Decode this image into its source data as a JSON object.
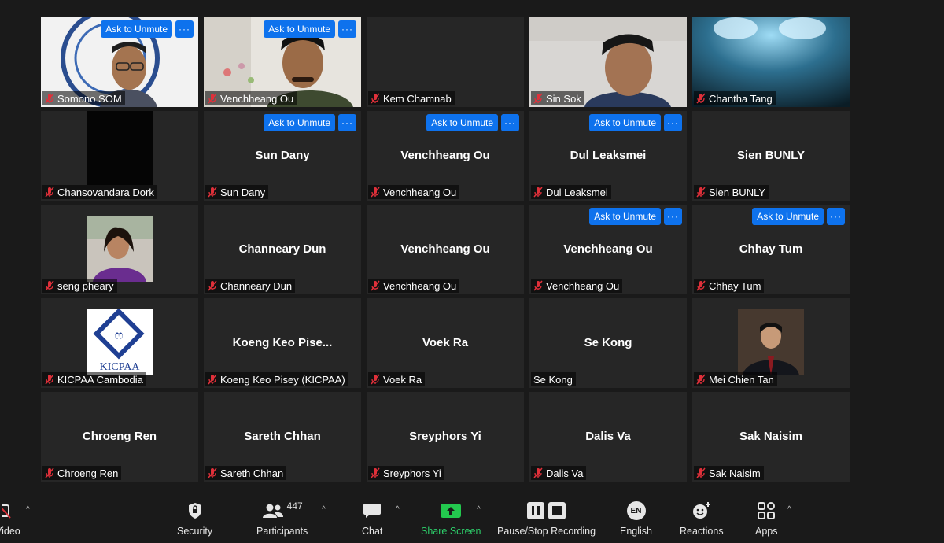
{
  "colors": {
    "accent": "#0e72ed",
    "share": "#23c84e",
    "mic_off": "#e0303a"
  },
  "unmute_label": "Ask to Unmute",
  "more_label": "···",
  "tiles": [
    {
      "name": "Somono SOM",
      "center": "",
      "video": "somono",
      "unmute": true
    },
    {
      "name": "Venchheang Ou",
      "center": "",
      "video": "venchheang",
      "unmute": true
    },
    {
      "name": "Kem Chamnab",
      "center": "",
      "video": "",
      "unmute": false
    },
    {
      "name": "Sin Sok",
      "center": "",
      "video": "sinsok",
      "unmute": false
    },
    {
      "name": "Chantha Tang",
      "center": "",
      "video": "chantha",
      "unmute": false
    },
    {
      "name": "Chansovandara Dork",
      "center": "",
      "video": "black",
      "unmute": false
    },
    {
      "name": "Sun Dany",
      "center": "Sun Dany",
      "video": "",
      "unmute": true
    },
    {
      "name": "Venchheang Ou",
      "center": "Venchheang Ou",
      "video": "",
      "unmute": true
    },
    {
      "name": "Dul Leaksmei",
      "center": "Dul Leaksmei",
      "video": "",
      "unmute": true
    },
    {
      "name": "Sien BUNLY",
      "center": "Sien BUNLY",
      "video": "",
      "unmute": false
    },
    {
      "name": "seng pheary",
      "center": "",
      "video": "photo-woman",
      "unmute": false
    },
    {
      "name": "Channeary Dun",
      "center": "Channeary Dun",
      "video": "",
      "unmute": false
    },
    {
      "name": "Venchheang Ou",
      "center": "Venchheang Ou",
      "video": "",
      "unmute": false
    },
    {
      "name": "Venchheang Ou",
      "center": "Venchheang Ou",
      "video": "",
      "unmute": true
    },
    {
      "name": "Chhay Tum",
      "center": "Chhay Tum",
      "video": "",
      "unmute": true
    },
    {
      "name": "KICPAA Cambodia",
      "center": "",
      "video": "kicpaa-logo",
      "unmute": false
    },
    {
      "name": "Koeng Keo Pisey (KICPAA)",
      "center": "Koeng  Keo  Pise...",
      "video": "",
      "unmute": false
    },
    {
      "name": "Voek Ra",
      "center": "Voek Ra",
      "video": "",
      "unmute": false
    },
    {
      "name": "Se Kong",
      "center": "Se Kong",
      "video": "",
      "unmute": false,
      "no_mic": true
    },
    {
      "name": "Mei Chien Tan",
      "center": "",
      "video": "photo-man",
      "unmute": false
    },
    {
      "name": "Chroeng Ren",
      "center": "Chroeng Ren",
      "video": "",
      "unmute": false
    },
    {
      "name": "Sareth Chhan",
      "center": "Sareth Chhan",
      "video": "",
      "unmute": false
    },
    {
      "name": "Sreyphors Yi",
      "center": "Sreyphors Yi",
      "video": "",
      "unmute": false
    },
    {
      "name": "Dalis Va",
      "center": "Dalis Va",
      "video": "",
      "unmute": false
    },
    {
      "name": "Sak Naisim",
      "center": "Sak Naisim",
      "video": "",
      "unmute": false
    }
  ],
  "kicpaa_text": "KICPAA",
  "toolbar": {
    "video_label": "Video",
    "security_label": "Security",
    "participants_label": "Participants",
    "participants_count": "447",
    "chat_label": "Chat",
    "share_label": "Share Screen",
    "record_label": "Pause/Stop Recording",
    "language_badge": "EN",
    "language_label": "English",
    "reactions_label": "Reactions",
    "apps_label": "Apps"
  }
}
